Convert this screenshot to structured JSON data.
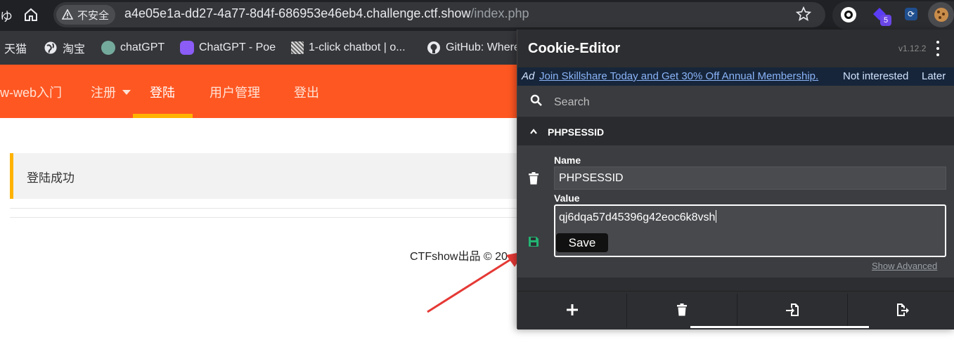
{
  "browser": {
    "security_label": "不安全",
    "url_host": "a4e05e1a-dd27-4a77-8d4f-686953e46eb4.challenge.ctf.show",
    "url_path": "/index.php",
    "extension_badge": "5"
  },
  "bookmarks": [
    {
      "label": "天猫",
      "icon": "tmall-icon"
    },
    {
      "label": "淘宝",
      "icon": "globe-icon"
    },
    {
      "label": "chatGPT",
      "icon": "chatgpt-icon"
    },
    {
      "label": "ChatGPT - Poe",
      "icon": "poe-icon"
    },
    {
      "label": "1-click chatbot | o...",
      "icon": "chatbot-icon"
    },
    {
      "label": "GitHub: Where",
      "icon": "github-icon"
    }
  ],
  "site": {
    "nav": {
      "brand": "w-web入门",
      "register": "注册",
      "login": "登陆",
      "user_manage": "用户管理",
      "logout": "登出"
    },
    "alert": "登陆成功",
    "footer": "CTFshow出品 © 20"
  },
  "cookie_editor": {
    "title": "Cookie-Editor",
    "version": "v1.12.2",
    "ad": {
      "label": "Ad",
      "text": "Join Skillshare Today and Get 30% Off Annual Membership.",
      "not_interested": "Not interested",
      "later": "Later"
    },
    "search_placeholder": "Search",
    "cookie": {
      "header": "PHPSESSID",
      "name_label": "Name",
      "name_value": "PHPSESSID",
      "value_label": "Value",
      "value": "qj6dqa57d45396g42eoc6k8vsh"
    },
    "save_label": "Save",
    "show_advanced": "Show Advanced"
  },
  "colors": {
    "site_accent": "#ff5722",
    "nav_underline": "#ffb300",
    "save_icon": "#22b573",
    "arrow": "#e53935"
  }
}
